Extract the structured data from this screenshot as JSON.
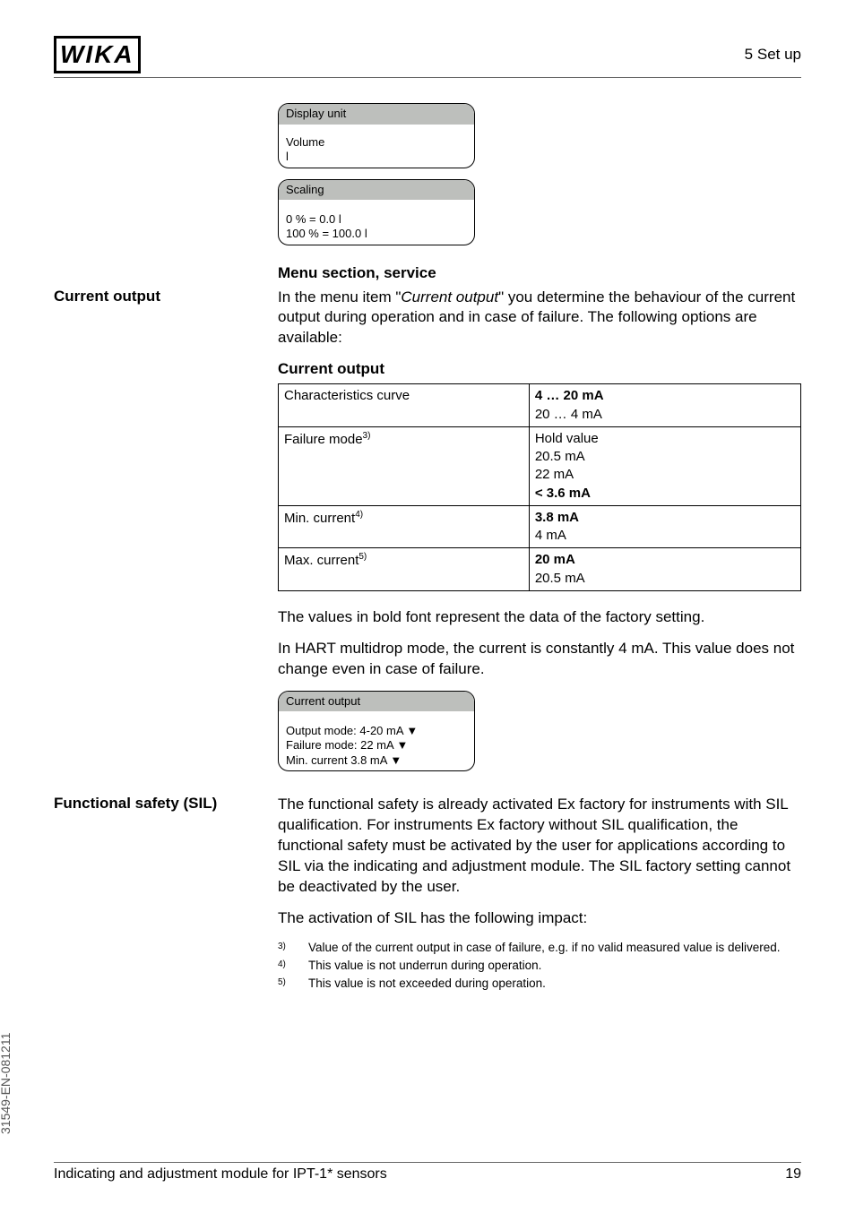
{
  "logo": "WIKA",
  "header_right": "5   Set up",
  "lcd1": {
    "title": "Display unit",
    "line1": "Volume",
    "line2": "l"
  },
  "lcd2": {
    "title": "Scaling",
    "line1": "0 % = 0.0 l",
    "line2": "100 % = 100.0 l"
  },
  "section_service": "Menu section, service",
  "labels": {
    "current_output": "Current output",
    "functional_safety": "Functional safety (SIL)"
  },
  "current_output_intro": "In the menu item \"Current output\" you determine the behaviour of the current output during operation and in case of failure. The following options are available:",
  "table_title": "Current output",
  "table": {
    "r1c1": "Characteristics curve",
    "r1c2a": "4 … 20 mA",
    "r1c2b": "20 … 4 mA",
    "r2c1": "Failure mode",
    "r2c1_sup": "3)",
    "r2c2a": "Hold value",
    "r2c2b": "20.5 mA",
    "r2c2c": "22 mA",
    "r2c2d": "< 3.6 mA",
    "r3c1": "Min. current",
    "r3c1_sup": "4)",
    "r3c2a": "3.8 mA",
    "r3c2b": "4 mA",
    "r4c1": "Max. current",
    "r4c1_sup": "5)",
    "r4c2a": "20 mA",
    "r4c2b": "20.5 mA"
  },
  "after_table_p1": "The values in bold font represent the data of the factory setting.",
  "after_table_p2": "In HART multidrop mode, the current is constantly 4 mA. This value does not change even in case of failure.",
  "lcd3": {
    "title": "Current output",
    "line1": "Output mode: 4-20 mA ▼",
    "line2": "Failure mode: 22 mA ▼",
    "line3": "Min. current 3.8 mA ▼"
  },
  "sil_para": "The functional safety is already activated Ex factory for instruments with SIL qualification. For instruments Ex factory without SIL qualification, the functional safety must be activated by the user for applications according to SIL via the indicating and adjustment module. The SIL factory setting cannot be deactivated by the user.",
  "sil_act": "The activation of SIL has the following impact:",
  "footnotes": [
    {
      "n": "3)",
      "t": "Value of the current output in case of failure, e.g. if no valid measured value is delivered."
    },
    {
      "n": "4)",
      "t": "This value is not underrun during operation."
    },
    {
      "n": "5)",
      "t": "This value is not exceeded during operation."
    }
  ],
  "footer_left": "Indicating and adjustment module for IPT-1* sensors",
  "footer_right": "19",
  "side_text": "31549-EN-081211"
}
